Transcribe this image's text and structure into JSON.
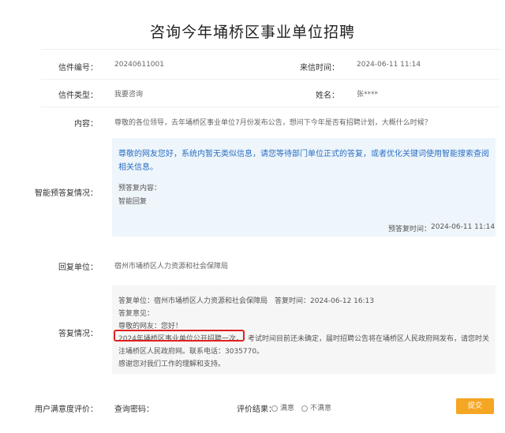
{
  "page": {
    "title": "咨询今年埇桥区事业单位招聘"
  },
  "letter": {
    "number_label": "信件编号：",
    "number": "20240611001",
    "time_label": "来信时间：",
    "time": "2024-06-11 11:14",
    "type_label": "信件类型：",
    "type": "我要咨询",
    "name_label": "姓名：",
    "name": "张****",
    "content_label": "内容：",
    "content": "尊敬的各位领导，去年埇桥区事业单位7月份发布公告，想问下今年是否有招聘计划，大概什么时候？"
  },
  "smart": {
    "label": "智能预答复情况：",
    "main_text": "尊敬的网友您好，系统内暂无类似信息，请您等待部门单位正式的答复，或者优化关键词使用智能搜索查阅相关信息。",
    "reply_content_label": "预答复内容：",
    "reply_content": "智能回复",
    "time_label": "预答复时间：",
    "time": "2024-06-11 11:14"
  },
  "reply_unit": {
    "label": "回复单位：",
    "value": "宿州市埇桥区人力资源和社会保障局"
  },
  "reply": {
    "label": "答复情况：",
    "line1": "答复单位：宿州市埇桥区人力资源和社会保障局　答复时间：2024-06-12 16:13",
    "line2": "答复意见：",
    "line3": "尊敬的网友：您好！",
    "line4_highlight": "2024年埇桥区事业单位公开招聘一次，",
    "line4_rest": "考试时间目前还未确定，届时招聘公告将在埇桥区人民政府网发布，请您时关",
    "line5": "注埇桥区人民政府网。联系电话：3035770。",
    "line6": "感谢您对我们工作的理解和支持。"
  },
  "rating": {
    "label": "用户满意度评价：",
    "code_label": "查询密码：",
    "result_label": "评价结果：",
    "option1": "满意",
    "option2": "不满意",
    "submit": "提交"
  }
}
